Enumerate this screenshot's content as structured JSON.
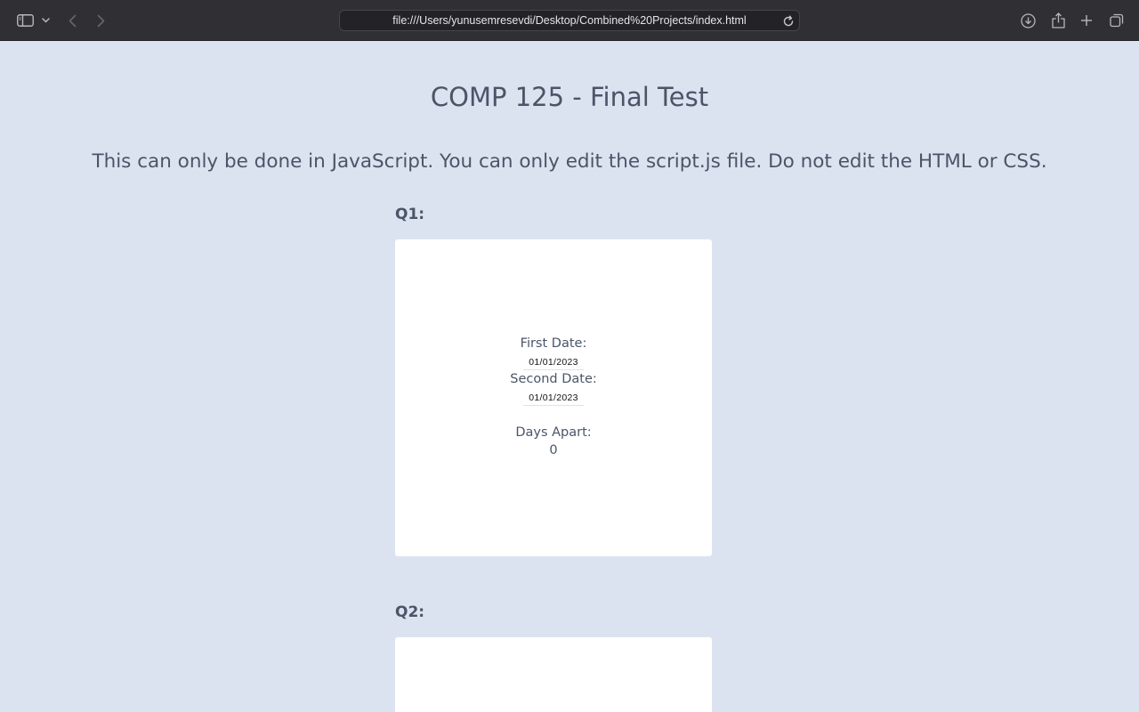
{
  "browser": {
    "url": "file:///Users/yunusemresevdi/Desktop/Combined%20Projects/index.html",
    "icons": [
      "sidebar-icon",
      "chevron-down-icon",
      "back-icon",
      "forward-icon",
      "reload-icon",
      "download-icon",
      "share-icon",
      "new-tab-icon",
      "tabs-overview-icon"
    ]
  },
  "page": {
    "title": "COMP 125 - Final Test",
    "instructions": "This can only be done in JavaScript. You can only edit the script.js file. Do not edit the HTML or CSS."
  },
  "q1": {
    "label": "Q1:",
    "first_date_label": "First Date:",
    "first_date_value": "01/01/2023",
    "second_date_label": "Second Date:",
    "second_date_value": "01/01/2023",
    "days_apart_label": "Days Apart:",
    "days_apart_value": "0"
  },
  "q2": {
    "label": "Q2:"
  },
  "colors": {
    "page_background": "#dce3f0",
    "text": "#4a5568",
    "card": "#ffffff",
    "toolbar": "#302f33"
  }
}
